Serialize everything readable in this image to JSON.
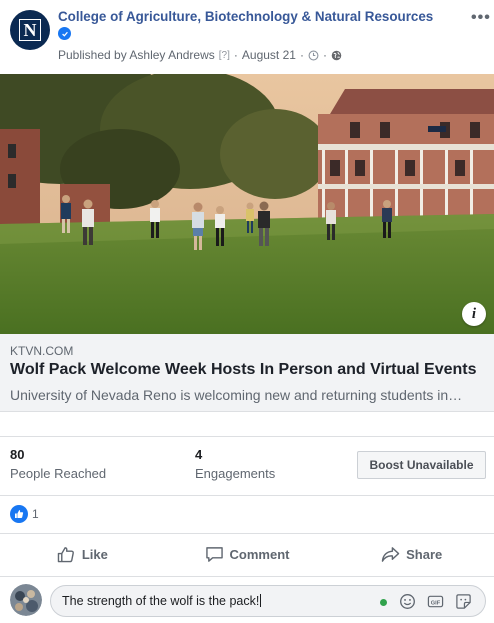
{
  "post": {
    "page_name": "College of Agriculture, Biotechnology & Natural Resources",
    "published_by": "Published by Ashley Andrews",
    "help_marker": "[?]",
    "date": "August 21"
  },
  "link": {
    "domain": "KTVN.COM",
    "title": "Wolf Pack Welcome Week Hosts In Person and Virtual Events",
    "description": "University of Nevada Reno is welcoming new and returning students in…"
  },
  "stats": {
    "reached_value": "80",
    "reached_label": "People Reached",
    "engagements_value": "4",
    "engagements_label": "Engagements",
    "boost_label": "Boost Unavailable"
  },
  "reactions": {
    "count": "1"
  },
  "actions": {
    "like": "Like",
    "comment": "Comment",
    "share": "Share"
  },
  "composer": {
    "text": "The strength of the wolf is the pack!"
  },
  "colors": {
    "brand_blue": "#1877f2",
    "link_blue": "#385898",
    "online_green": "#31a24c"
  }
}
